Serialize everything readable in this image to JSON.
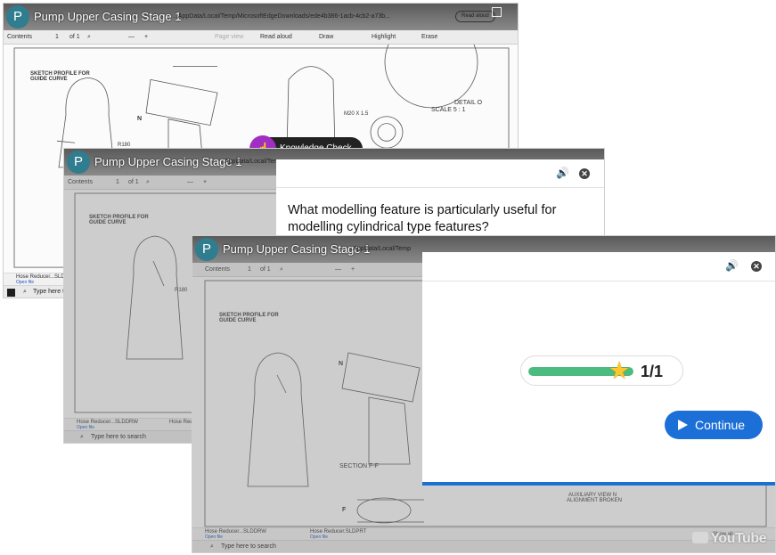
{
  "video_title": "Pump Upper Casing Stage 1",
  "avatar_letter": "P",
  "address": "...AppData/Local/Temp/MicrosoftEdgeDownloads/ede4b386-1acb-4cb2-a73b...",
  "address_short": "AppData/Local/Temp",
  "read_aloud_pill": "Read aloud",
  "toolbar": {
    "contents": "Contents",
    "page": "1",
    "of": "of 1",
    "minus": "—",
    "plus": "+",
    "page_view": "Page view",
    "read_aloud": "Read aloud",
    "draw": "Draw",
    "highlight": "Highlight",
    "erase": "Erase"
  },
  "drawing": {
    "sketch_profile": "SKETCH PROFILE FOR",
    "guide_curve": "GUIDE CURVE",
    "detail": "DETAIL O",
    "scale": "SCALE 5 : 1",
    "m20": "M20 X 1.5",
    "section": "SECTION F-F",
    "auxiliary": "AUXILIARY VIEW N",
    "alignment": "ALIGNMENT BROKEN",
    "n": "N",
    "r": "R180",
    "f": "F"
  },
  "downloads": [
    {
      "name": "Hose Reducer...SLDDRW",
      "action": "Open file"
    },
    {
      "name": "Hose Reducer.SLDPRT",
      "action": "Open file"
    }
  ],
  "show_all": "Show all",
  "taskbar": {
    "search": "Type here to search"
  },
  "knowledge_check": {
    "label": "Knowledge Check",
    "icon": "pointer-hand-icon"
  },
  "question": {
    "text": "What modelling feature is particularly useful for modelling cylindrical type features?"
  },
  "result": {
    "progress_fraction": 1.0,
    "score": "1/1",
    "continue_label": "Continue"
  },
  "watermark": "YouTube",
  "colors": {
    "accent_blue": "#1b6fd6",
    "progress_green": "#4cbb7f",
    "star_gold": "#ffc62e",
    "knowledge_purple": "#a12ec2"
  }
}
